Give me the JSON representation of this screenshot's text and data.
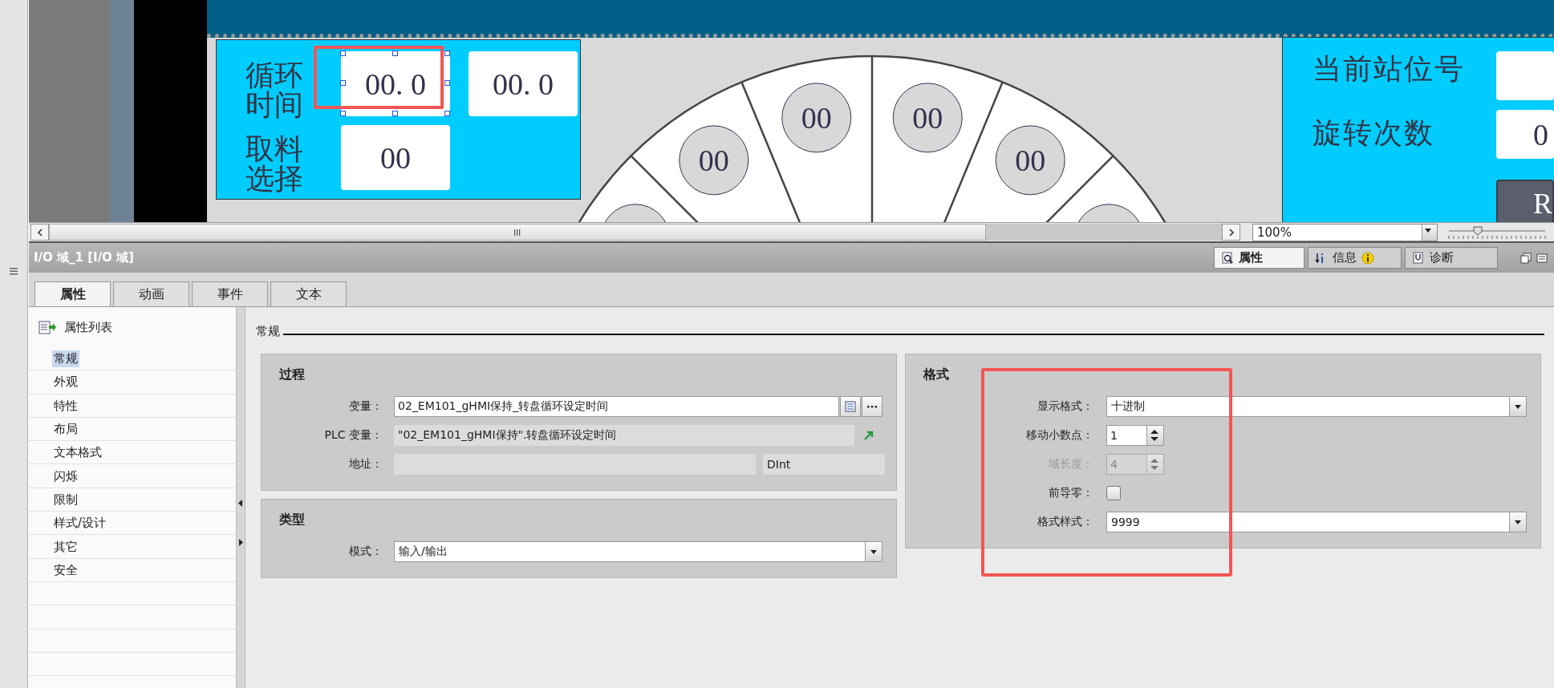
{
  "editor": {
    "left_panel": {
      "rows": [
        {
          "label": "循环时间",
          "fields": [
            {
              "value": "00. 0",
              "selected": true,
              "highlighted": true
            },
            {
              "value": "00. 0",
              "selected": false,
              "highlighted": false
            }
          ]
        },
        {
          "label": "取料选择",
          "fields": [
            {
              "value": "00",
              "selected": false,
              "highlighted": false
            }
          ]
        }
      ]
    },
    "wheel": {
      "slots": [
        {
          "value": "00"
        },
        {
          "value": "00"
        },
        {
          "value": "00"
        },
        {
          "value": "00"
        }
      ]
    },
    "right_panel": {
      "rows": [
        {
          "label": "当前站位号"
        },
        {
          "label": "旋转次数",
          "value": "0"
        }
      ],
      "button": {
        "label": "R"
      }
    }
  },
  "zoom": {
    "value": "100%",
    "level": 0.3
  },
  "inspector": {
    "title": "I/O 域_1 [I/O 域]",
    "view_tabs": [
      {
        "label": "属性",
        "selected": true,
        "info": false
      },
      {
        "label": "信息",
        "selected": false,
        "info": true
      },
      {
        "label": "诊断",
        "selected": false,
        "info": false
      }
    ],
    "tabs": [
      {
        "label": "属性",
        "selected": true
      },
      {
        "label": "动画",
        "selected": false
      },
      {
        "label": "事件",
        "selected": false
      },
      {
        "label": "文本",
        "selected": false
      }
    ],
    "sidebar": {
      "title": "属性列表",
      "items": [
        {
          "label": "常规",
          "selected": true
        },
        {
          "label": "外观",
          "selected": false
        },
        {
          "label": "特性",
          "selected": false
        },
        {
          "label": "布局",
          "selected": false
        },
        {
          "label": "文本格式",
          "selected": false
        },
        {
          "label": "闪烁",
          "selected": false
        },
        {
          "label": "限制",
          "selected": false
        },
        {
          "label": "样式/设计",
          "selected": false
        },
        {
          "label": "其它",
          "selected": false
        },
        {
          "label": "安全",
          "selected": false
        }
      ]
    },
    "section_title": "常规",
    "columns": [
      {
        "groups": [
          {
            "title": "过程",
            "highlighted": false,
            "rows": [
              {
                "kind": "tag",
                "label": "变量：",
                "value": "02_EM101_gHMI保持_转盘循环设定时间"
              },
              {
                "kind": "readonly",
                "label": "PLC 变量：",
                "value": "\"02_EM101_gHMI保持\".转盘循环设定时间"
              },
              {
                "kind": "address",
                "label": "地址：",
                "type": "DInt"
              }
            ]
          },
          {
            "title": "类型",
            "highlighted": false,
            "rows": [
              {
                "kind": "combo",
                "label": "模式：",
                "value": "输入/输出"
              }
            ]
          }
        ]
      },
      {
        "groups": [
          {
            "title": "格式",
            "highlighted": true,
            "rows": [
              {
                "kind": "combo",
                "label": "显示格式：",
                "value": "十进制"
              },
              {
                "kind": "spin",
                "label": "移动小数点：",
                "value": "1",
                "disabled": false
              },
              {
                "kind": "spin",
                "label": "域长度：",
                "value": "4",
                "disabled": true
              },
              {
                "kind": "checkbox",
                "label": "前导零：",
                "checked": false
              },
              {
                "kind": "combo",
                "label": "格式样式：",
                "value": "9999"
              }
            ]
          }
        ]
      }
    ]
  }
}
